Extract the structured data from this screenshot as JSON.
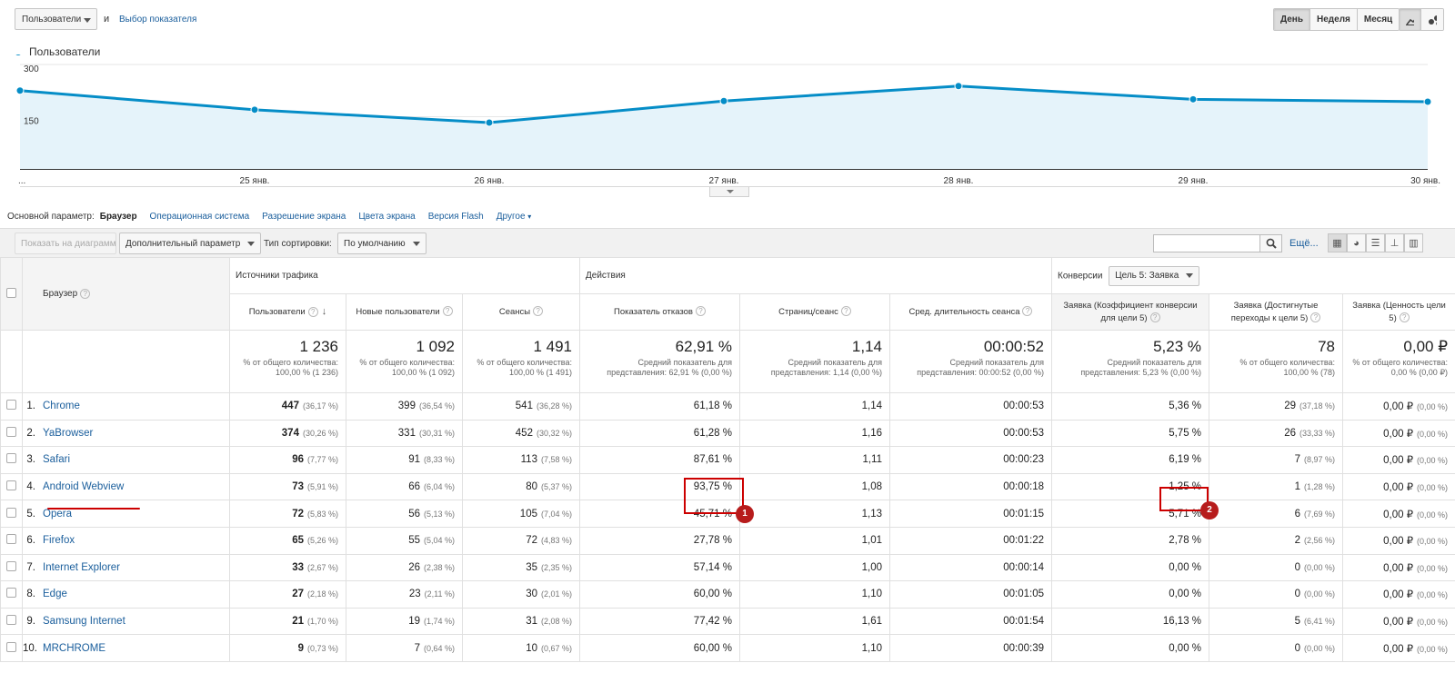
{
  "top": {
    "metric_select": "Пользователи",
    "and_label": "и",
    "choose_metric": "Выбор показателя",
    "period_buttons": [
      "День",
      "Неделя",
      "Месяц"
    ],
    "active_period": "День"
  },
  "chart_data": {
    "type": "area",
    "legend": "Пользователи",
    "color": "#058dc7",
    "fill": "#e5f3fa",
    "y_ticks": [
      300,
      150
    ],
    "ylim": [
      0,
      300
    ],
    "x_labels": [
      "...",
      "25 янв.",
      "26 янв.",
      "27 янв.",
      "28 янв.",
      "29 янв.",
      "30 янв."
    ],
    "values": [
      225,
      170,
      133,
      195,
      238,
      200,
      193
    ]
  },
  "dims": {
    "label": "Основной параметр:",
    "current": "Браузер",
    "others": [
      "Операционная система",
      "Разрешение экрана",
      "Цвета экрана",
      "Версия Flash"
    ],
    "more": "Другое"
  },
  "toolbar": {
    "show_on_chart": "Показать на диаграмме",
    "secondary_param": "Дополнительный параметр",
    "sort_type_label": "Тип сортировки:",
    "sort_default": "По умолчанию",
    "more_link": "Ещё..."
  },
  "table": {
    "col_browser": "Браузер",
    "group_traffic": "Источники трафика",
    "group_actions": "Действия",
    "group_conversions": "Конверсии",
    "goal_select": "Цель 5: Заявка",
    "columns": [
      "Пользователи",
      "Новые пользователи",
      "Сеансы",
      "Показатель отказов",
      "Страниц/сеанс",
      "Сред. длительность сеанса",
      "Заявка (Коэффициент конверсии для цели 5)",
      "Заявка (Достигнутые переходы к цели 5)",
      "Заявка (Ценность цели 5)"
    ],
    "totals": [
      {
        "big": "1 236",
        "small": "% от общего количества: 100,00 % (1 236)"
      },
      {
        "big": "1 092",
        "small": "% от общего количества: 100,00 % (1 092)"
      },
      {
        "big": "1 491",
        "small": "% от общего количества: 100,00 % (1 491)"
      },
      {
        "big": "62,91 %",
        "small": "Средний показатель для представления: 62,91 % (0,00 %)"
      },
      {
        "big": "1,14",
        "small": "Средний показатель для представления: 1,14 (0,00 %)"
      },
      {
        "big": "00:00:52",
        "small": "Средний показатель для представления: 00:00:52 (0,00 %)"
      },
      {
        "big": "5,23 %",
        "small": "Средний показатель для представления: 5,23 % (0,00 %)"
      },
      {
        "big": "78",
        "small": "% от общего количества: 100,00 % (78)"
      },
      {
        "big": "0,00 ₽",
        "small": "% от общего количества: 0,00 % (0,00 ₽)"
      }
    ],
    "rows": [
      {
        "idx": "1.",
        "name": "Chrome",
        "users": "447",
        "users_pct": "(36,17 %)",
        "new": "399",
        "new_pct": "(36,54 %)",
        "sessions": "541",
        "sessions_pct": "(36,28 %)",
        "bounce": "61,18 %",
        "pps": "1,14",
        "dur": "00:00:53",
        "conv": "5,36 %",
        "goals": "29",
        "goals_pct": "(37,18 %)",
        "value": "0,00 ₽",
        "value_pct": "(0,00 %)"
      },
      {
        "idx": "2.",
        "name": "YaBrowser",
        "users": "374",
        "users_pct": "(30,26 %)",
        "new": "331",
        "new_pct": "(30,31 %)",
        "sessions": "452",
        "sessions_pct": "(30,32 %)",
        "bounce": "61,28 %",
        "pps": "1,16",
        "dur": "00:00:53",
        "conv": "5,75 %",
        "goals": "26",
        "goals_pct": "(33,33 %)",
        "value": "0,00 ₽",
        "value_pct": "(0,00 %)"
      },
      {
        "idx": "3.",
        "name": "Safari",
        "users": "96",
        "users_pct": "(7,77 %)",
        "new": "91",
        "new_pct": "(8,33 %)",
        "sessions": "113",
        "sessions_pct": "(7,58 %)",
        "bounce": "87,61 %",
        "pps": "1,11",
        "dur": "00:00:23",
        "conv": "6,19 %",
        "goals": "7",
        "goals_pct": "(8,97 %)",
        "value": "0,00 ₽",
        "value_pct": "(0,00 %)"
      },
      {
        "idx": "4.",
        "name": "Android Webview",
        "users": "73",
        "users_pct": "(5,91 %)",
        "new": "66",
        "new_pct": "(6,04 %)",
        "sessions": "80",
        "sessions_pct": "(5,37 %)",
        "bounce": "93,75 %",
        "pps": "1,08",
        "dur": "00:00:18",
        "conv": "1,25 %",
        "goals": "1",
        "goals_pct": "(1,28 %)",
        "value": "0,00 ₽",
        "value_pct": "(0,00 %)"
      },
      {
        "idx": "5.",
        "name": "Opera",
        "users": "72",
        "users_pct": "(5,83 %)",
        "new": "56",
        "new_pct": "(5,13 %)",
        "sessions": "105",
        "sessions_pct": "(7,04 %)",
        "bounce": "45,71 %",
        "pps": "1,13",
        "dur": "00:01:15",
        "conv": "5,71 %",
        "goals": "6",
        "goals_pct": "(7,69 %)",
        "value": "0,00 ₽",
        "value_pct": "(0,00 %)"
      },
      {
        "idx": "6.",
        "name": "Firefox",
        "users": "65",
        "users_pct": "(5,26 %)",
        "new": "55",
        "new_pct": "(5,04 %)",
        "sessions": "72",
        "sessions_pct": "(4,83 %)",
        "bounce": "27,78 %",
        "pps": "1,01",
        "dur": "00:01:22",
        "conv": "2,78 %",
        "goals": "2",
        "goals_pct": "(2,56 %)",
        "value": "0,00 ₽",
        "value_pct": "(0,00 %)"
      },
      {
        "idx": "7.",
        "name": "Internet Explorer",
        "users": "33",
        "users_pct": "(2,67 %)",
        "new": "26",
        "new_pct": "(2,38 %)",
        "sessions": "35",
        "sessions_pct": "(2,35 %)",
        "bounce": "57,14 %",
        "pps": "1,00",
        "dur": "00:00:14",
        "conv": "0,00 %",
        "goals": "0",
        "goals_pct": "(0,00 %)",
        "value": "0,00 ₽",
        "value_pct": "(0,00 %)"
      },
      {
        "idx": "8.",
        "name": "Edge",
        "users": "27",
        "users_pct": "(2,18 %)",
        "new": "23",
        "new_pct": "(2,11 %)",
        "sessions": "30",
        "sessions_pct": "(2,01 %)",
        "bounce": "60,00 %",
        "pps": "1,10",
        "dur": "00:01:05",
        "conv": "0,00 %",
        "goals": "0",
        "goals_pct": "(0,00 %)",
        "value": "0,00 ₽",
        "value_pct": "(0,00 %)"
      },
      {
        "idx": "9.",
        "name": "Samsung Internet",
        "users": "21",
        "users_pct": "(1,70 %)",
        "new": "19",
        "new_pct": "(1,74 %)",
        "sessions": "31",
        "sessions_pct": "(2,08 %)",
        "bounce": "77,42 %",
        "pps": "1,61",
        "dur": "00:01:54",
        "conv": "16,13 %",
        "goals": "5",
        "goals_pct": "(6,41 %)",
        "value": "0,00 ₽",
        "value_pct": "(0,00 %)"
      },
      {
        "idx": "10.",
        "name": "MRCHROME",
        "users": "9",
        "users_pct": "(0,73 %)",
        "new": "7",
        "new_pct": "(0,64 %)",
        "sessions": "10",
        "sessions_pct": "(0,67 %)",
        "bounce": "60,00 %",
        "pps": "1,10",
        "dur": "00:00:39",
        "conv": "0,00 %",
        "goals": "0",
        "goals_pct": "(0,00 %)",
        "value": "0,00 ₽",
        "value_pct": "(0,00 %)"
      }
    ]
  },
  "annotations": {
    "badge1": "1",
    "badge2": "2"
  },
  "colors": {
    "link": "#1a5e9c",
    "accent": "#058dc7",
    "highlight": "#cc0000"
  }
}
